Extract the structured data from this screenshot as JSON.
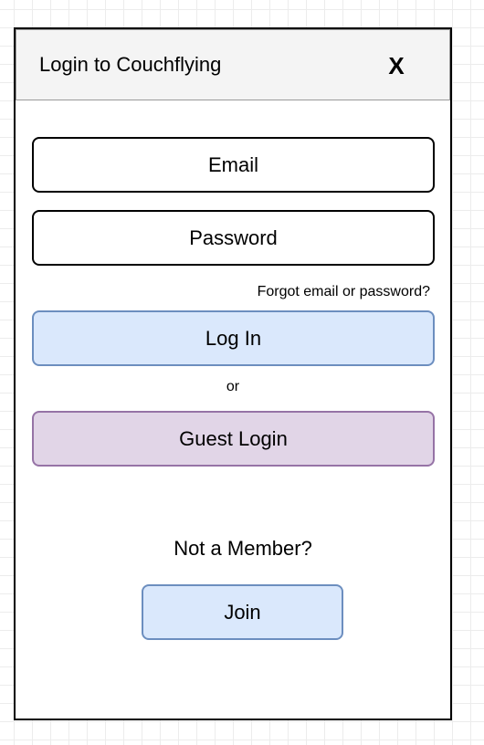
{
  "dialog": {
    "title": "Login to Couchflying",
    "close_label": "X"
  },
  "form": {
    "email_placeholder": "Email",
    "password_placeholder": "Password",
    "forgot_link": "Forgot email or password?",
    "login_label": "Log In",
    "or_text": "or",
    "guest_label": "Guest Login"
  },
  "signup": {
    "prompt": "Not a Member?",
    "join_label": "Join"
  },
  "colors": {
    "login_fill": "#dae8fc",
    "login_border": "#6c8ebf",
    "guest_fill": "#e1d5e7",
    "guest_border": "#9673a6",
    "header_fill": "#f4f4f4"
  }
}
